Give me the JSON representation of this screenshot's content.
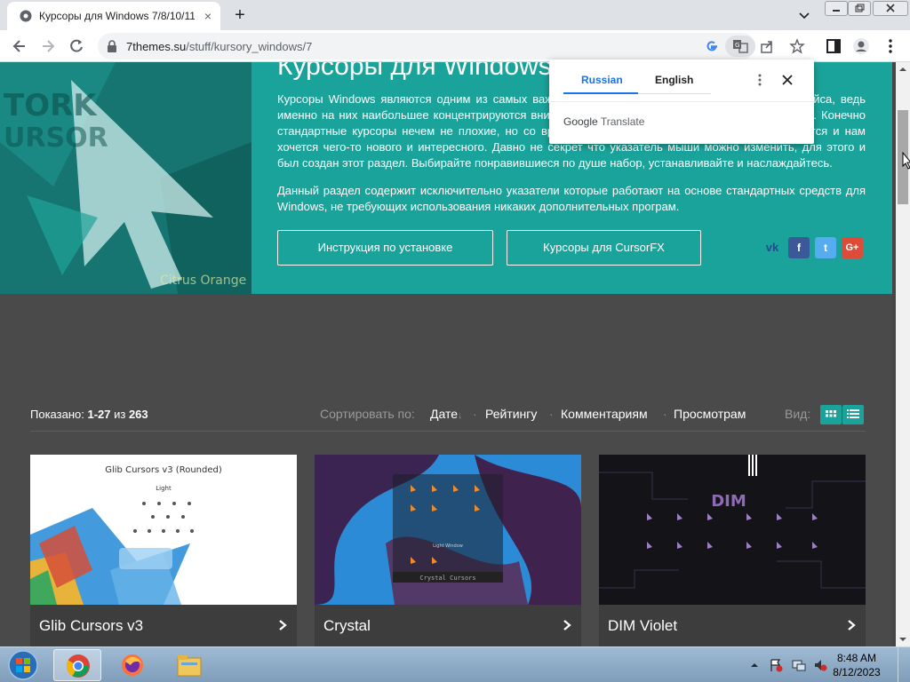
{
  "browser": {
    "tab_title": "Курсоры для Windows 7/8/10/11",
    "tab_close": "×",
    "new_tab": "+",
    "url_host": "7themes.su",
    "url_path": "/stuff/kursory_windows/7"
  },
  "hero": {
    "title": "Курсоры для Windows",
    "paragraph1": "Курсоры Windows являются одним из самых важных элементов системы, а не только интерфейса, ведь именно на них наибольшее концентрируются внимание пользователя при работе с компьютером. Конечно стандартные курсоры нечем не плохие, но со временем они надоедают и приедаются, и хочется и нам хочется чего-то нового и интересного. Давно не секрет что указатель мыши можно изменить, для этого и был создан этот раздел. Выбирайте понравившиеся по душе набор, устанавливайте и наслаждайтесь.",
    "paragraph2": "Данный раздел содержит исключительно указатели которые работают на основе стандартных средств для Windows, не требующих использования никаких дополнительных програм.",
    "button_install": "Инструкция по установке",
    "button_cursorfx": "Курсоры для CursorFX",
    "social": {
      "vk": "vk",
      "fb": "f",
      "tw": "t",
      "gp": "G+"
    }
  },
  "listing": {
    "shown_label": "Показано: ",
    "shown_range": "1-27",
    "shown_of": " из ",
    "shown_total": "263",
    "sort_label": "Сортировать по:",
    "sort_options": [
      "Дате",
      "Рейтингу",
      "Комментариям",
      "Просмотрам"
    ],
    "sort_arrow": "↓",
    "sort_separator": "·",
    "view_label": "Вид:"
  },
  "cards": [
    {
      "title": "Glib Cursors v3",
      "thumb_title": "Glib Cursors v3 (Rounded)",
      "thumb_sub": "Light"
    },
    {
      "title": "Crystal",
      "thumb_title": "Crystal Cursors",
      "thumb_sub": "Light Window"
    },
    {
      "title": "DIM Violet",
      "thumb_title": "DIM"
    }
  ],
  "translate_popup": {
    "lang_source": "Russian",
    "lang_target": "English",
    "brand_google": "Google",
    "brand_translate": " Translate"
  },
  "taskbar": {
    "time": "8:48 AM",
    "date": "8/12/2023"
  },
  "colors": {
    "accent": "#1aa39a",
    "page_dark": "#4a4a4a",
    "chrome_frame": "#dee1e6",
    "translate_blue": "#1a73e8"
  },
  "icons": [
    "chrome-favicon",
    "back-icon",
    "forward-icon",
    "reload-icon",
    "lock-icon",
    "google-icon",
    "translate-icon",
    "share-icon",
    "bookmark-star-icon",
    "sidepanel-icon",
    "profile-icon",
    "kebab-menu-icon",
    "grid-view-icon",
    "list-view-icon",
    "chevron-right-icon",
    "windows-start-icon",
    "chrome-icon",
    "firefox-icon",
    "explorer-icon",
    "volume-muted-icon",
    "network-icon",
    "flag-icon"
  ]
}
